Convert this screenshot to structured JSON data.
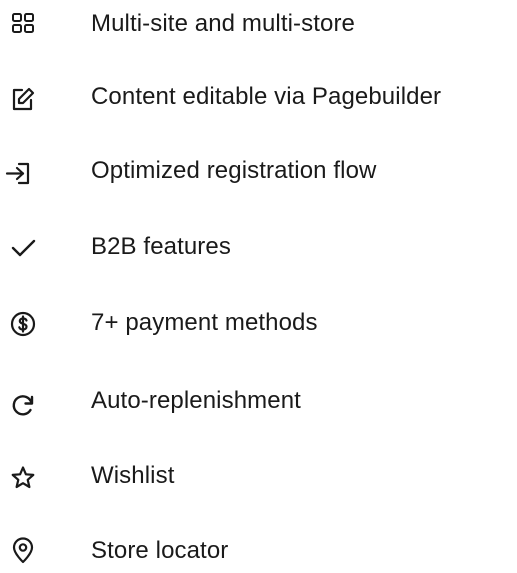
{
  "features": [
    {
      "icon": "grid-icon",
      "label": "Multi-site and multi-store"
    },
    {
      "icon": "edit-icon",
      "label": "Content editable via Pagebuilder"
    },
    {
      "icon": "sign-in-icon",
      "label": "Optimized registration flow"
    },
    {
      "icon": "check-icon",
      "label": "B2B features"
    },
    {
      "icon": "dollar-circle-icon",
      "label": "7+ payment methods"
    },
    {
      "icon": "refresh-icon",
      "label": "Auto-replenishment"
    },
    {
      "icon": "star-icon",
      "label": "Wishlist"
    },
    {
      "icon": "map-pin-icon",
      "label": "Store locator"
    }
  ]
}
